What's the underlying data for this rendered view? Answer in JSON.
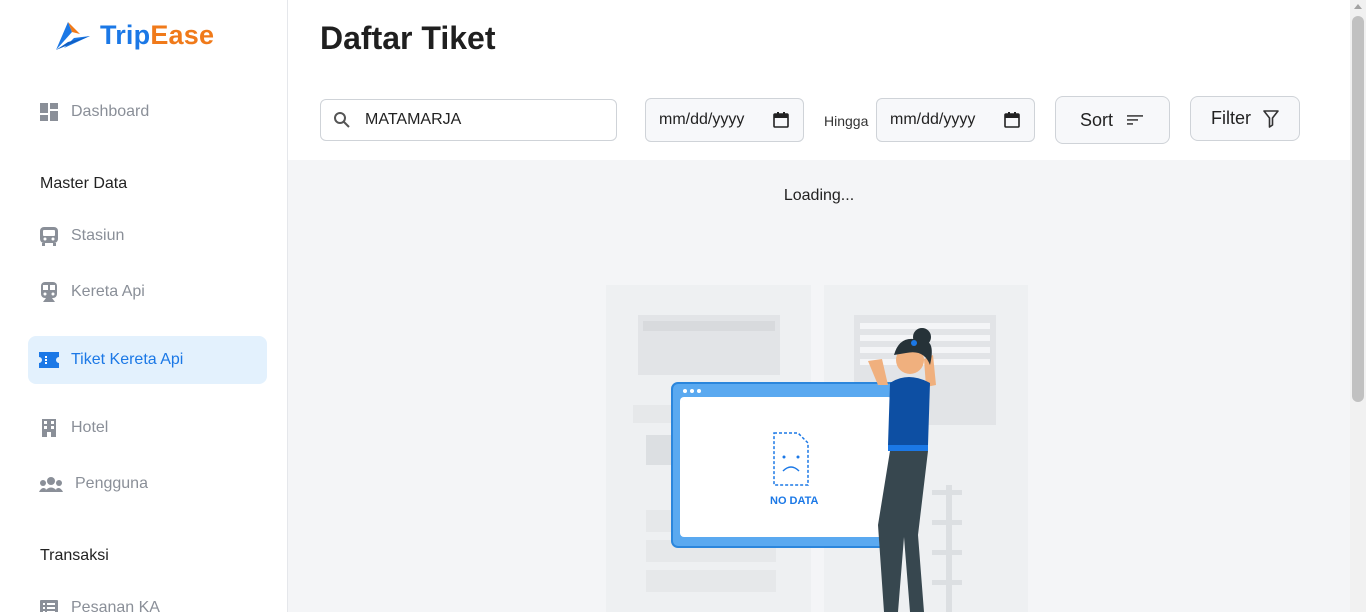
{
  "app": {
    "brand_part1": "Trip",
    "brand_part2": "Ease"
  },
  "sidebar": {
    "dashboard": "Dashboard",
    "section_master": "Master Data",
    "stasiun": "Stasiun",
    "kereta_api": "Kereta Api",
    "tiket_kereta_api": "Tiket Kereta Api",
    "hotel": "Hotel",
    "pengguna": "Pengguna",
    "section_transaksi": "Transaksi",
    "pesanan_ka": "Pesanan KA"
  },
  "main": {
    "title": "Daftar Tiket",
    "search_value": "MATAMARJA",
    "date_from_placeholder": "mm/dd/yyyy",
    "hingga_label": "Hingga",
    "date_to_placeholder": "mm/dd/yyyy",
    "sort_label": "Sort",
    "filter_label": "Filter",
    "loading_text": "Loading...",
    "no_data_text": "NO DATA"
  },
  "colors": {
    "accent": "#1b78e6",
    "brand_orange": "#f07a1a",
    "active_bg": "#e3f1fd"
  },
  "icons": [
    "dashboard-icon",
    "bus-icon",
    "train-icon",
    "ticket-icon",
    "building-icon",
    "users-icon",
    "list-icon",
    "search-icon",
    "calendar-icon",
    "sort-icon",
    "filter-icon"
  ]
}
